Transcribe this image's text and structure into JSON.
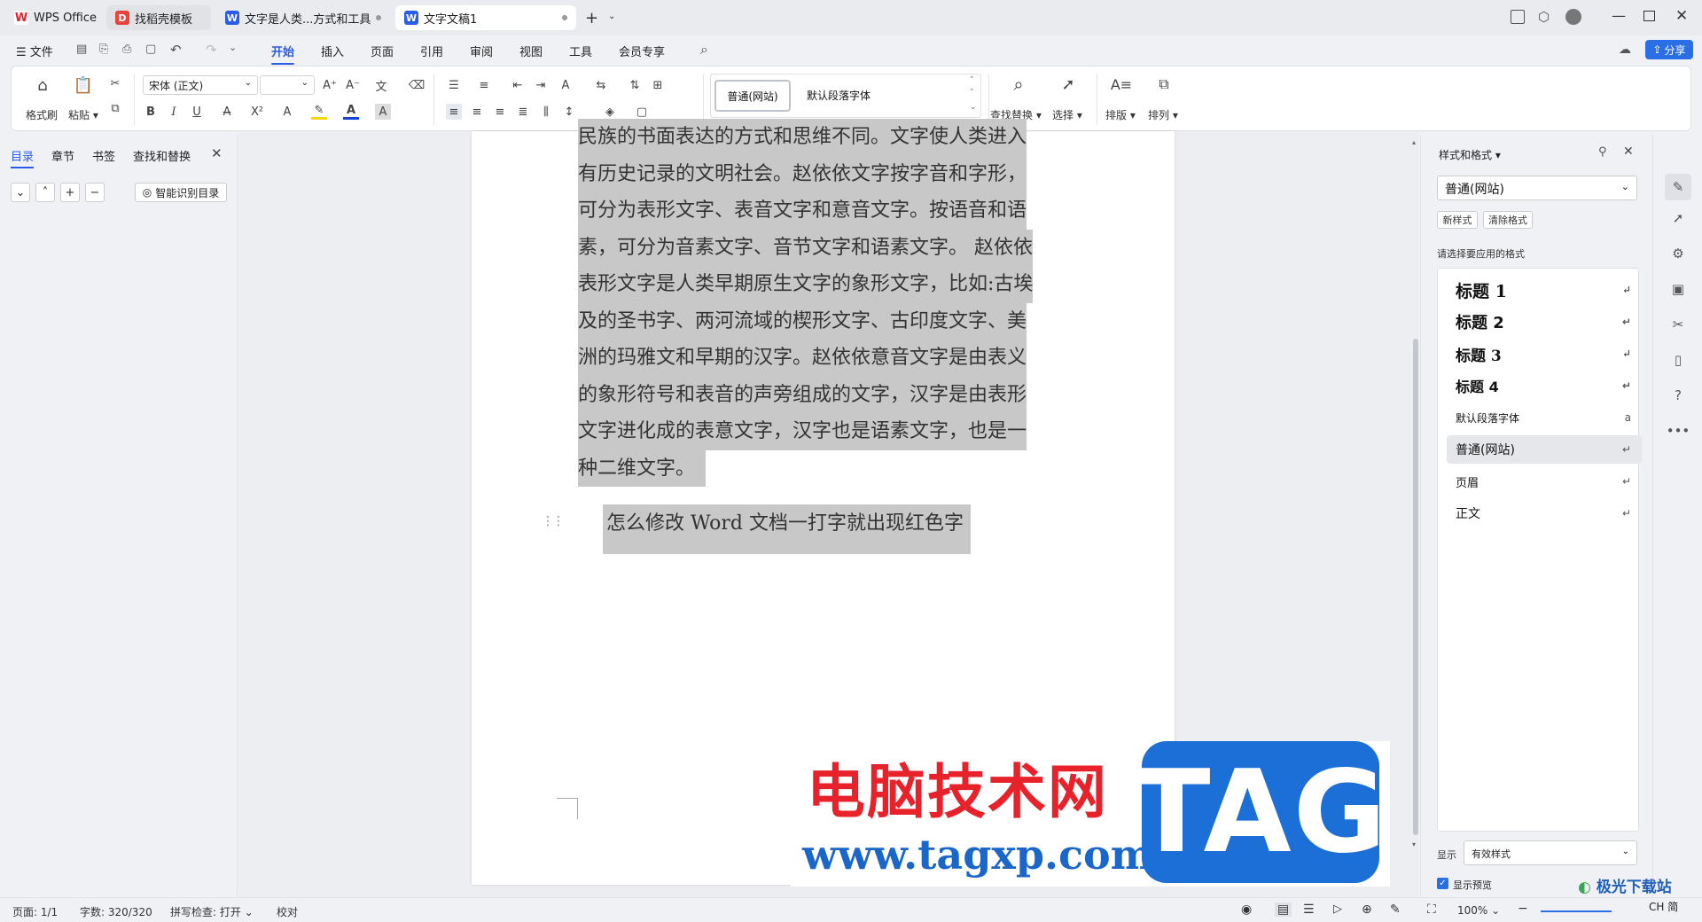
{
  "tabs": [
    {
      "label": "WPS Office"
    },
    {
      "label": "找稻壳模板"
    },
    {
      "label": "文字是人类...方式和工具"
    },
    {
      "label": "文字文稿1"
    }
  ],
  "menu": {
    "file": "文件",
    "items": [
      "开始",
      "插入",
      "页面",
      "引用",
      "审阅",
      "视图",
      "工具",
      "会员专享"
    ],
    "active": "开始",
    "share": "分享"
  },
  "ribbon": {
    "format_painter": "格式刷",
    "paste": "粘贴",
    "font_name": "宋体 (正文)",
    "font_size": "",
    "style_normal_web": "普通(网站)",
    "style_default_para_font": "默认段落字体",
    "find_replace": "查找替换",
    "select": "选择",
    "layout": "排版",
    "arrange": "排列"
  },
  "left_panel": {
    "tabs": [
      "目录",
      "章节",
      "书签",
      "查找和替换"
    ],
    "smart_toc": "智能识别目录"
  },
  "document": {
    "lines": [
      "民族的书面表达的方式和思维不同。文字使人类进入",
      "有历史记录的文明社会。赵依依文字按字音和字形，",
      "可分为表形文字、表音文字和意音文字。按语音和语",
      "素，可分为音素文字、音节文字和语素文字。 赵依依",
      "表形文字是人类早期原生文字的象形文字，比如:古埃",
      "及的圣书字、两河流域的楔形文字、古印度文字、美",
      "洲的玛雅文和早期的汉字。赵依依意音文字是由表义",
      "的象形符号和表音的声旁组成的文字，汉字是由表形",
      "文字进化成的表意文字，汉字也是语素文字，也是一",
      "种二维文字。"
    ],
    "heading": "怎么修改 Word 文档一打字就出现红色字"
  },
  "right_panel": {
    "title": "样式和格式",
    "current_style": "普通(网站)",
    "new_style": "新样式",
    "clear_format": "清除格式",
    "prompt": "请选择要应用的格式",
    "styles": [
      {
        "label": "标题  1",
        "mark": "↵"
      },
      {
        "label": "标题  2",
        "mark": "↵"
      },
      {
        "label": "标题  3",
        "mark": "↵"
      },
      {
        "label": "标题  4",
        "mark": "↵"
      },
      {
        "label": "默认段落字体",
        "mark": "a"
      },
      {
        "label": "普通(网站)",
        "mark": "↵"
      },
      {
        "label": "页眉",
        "mark": "↵"
      },
      {
        "label": "正文",
        "mark": "↵"
      }
    ],
    "show_label": "显示",
    "show_value": "有效样式",
    "preview_label": "显示预览"
  },
  "status": {
    "page": "页面: 1/1",
    "words": "字数: 320/320",
    "spell": "拼写检查: 打开",
    "proof": "校对",
    "zoom": "100%"
  },
  "watermark": {
    "cn": "电脑技术网",
    "url": "www.tagxp.com",
    "tag": "TAG",
    "corner": "极光下载站",
    "ime": "CH 简"
  }
}
